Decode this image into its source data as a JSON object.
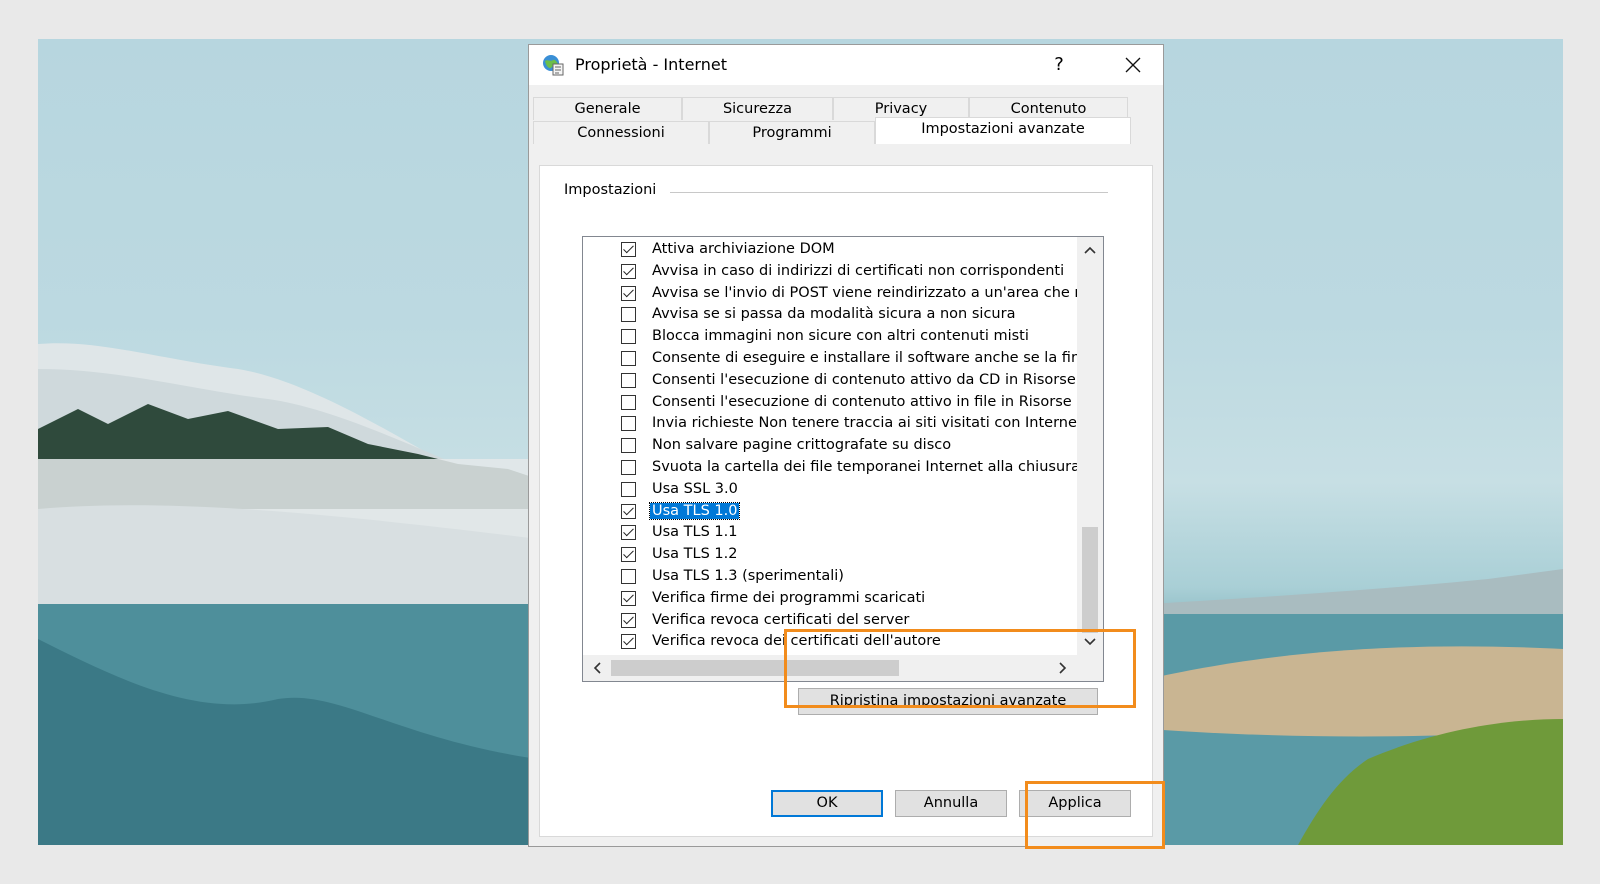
{
  "window": {
    "title": "Proprietà - Internet",
    "help_label": "?",
    "close_icon": "close-icon"
  },
  "tabs": {
    "row1": [
      "Generale",
      "Sicurezza",
      "Privacy",
      "Contenuto"
    ],
    "row2": [
      "Connessioni",
      "Programmi",
      "Impostazioni avanzate"
    ],
    "active": "Impostazioni avanzate"
  },
  "settings": {
    "group_label": "Impostazioni",
    "items": [
      {
        "label": "Attiva archiviazione DOM",
        "checked": true
      },
      {
        "label": "Avvisa in caso di indirizzi di certificati non corrispondenti",
        "checked": true
      },
      {
        "label": "Avvisa se l'invio di POST viene reindirizzato a un'area che r",
        "checked": true
      },
      {
        "label": "Avvisa se si passa da modalità sicura a non sicura",
        "checked": false
      },
      {
        "label": "Blocca immagini non sicure con altri contenuti misti",
        "checked": false
      },
      {
        "label": "Consente di eseguire e installare il software anche se la fir",
        "checked": false
      },
      {
        "label": "Consenti l'esecuzione di contenuto attivo da CD in Risorse",
        "checked": false
      },
      {
        "label": "Consenti l'esecuzione di contenuto attivo in file in Risorse c",
        "checked": false
      },
      {
        "label": "Invia richieste Non tenere traccia ai siti visitati con Interne",
        "checked": false
      },
      {
        "label": "Non salvare pagine crittografate su disco",
        "checked": false
      },
      {
        "label": "Svuota la cartella dei file temporanei Internet alla chiusura",
        "checked": false
      },
      {
        "label": "Usa SSL 3.0",
        "checked": false
      },
      {
        "label": "Usa TLS 1.0",
        "checked": true,
        "selected": true
      },
      {
        "label": "Usa TLS 1.1",
        "checked": true
      },
      {
        "label": "Usa TLS 1.2",
        "checked": true
      },
      {
        "label": "Usa TLS 1.3 (sperimentali)",
        "checked": false
      },
      {
        "label": "Verifica firme dei programmi scaricati",
        "checked": true
      },
      {
        "label": "Verifica revoca certificati del server",
        "checked": true
      },
      {
        "label": "Verifica revoca dei certificati dell'autore",
        "checked": true
      }
    ]
  },
  "buttons": {
    "reset": "Ripristina impostazioni avanzate",
    "ok": "OK",
    "cancel": "Annulla",
    "apply": "Applica"
  },
  "colors": {
    "highlight": "#f28c1c",
    "selection": "#0078d7"
  }
}
